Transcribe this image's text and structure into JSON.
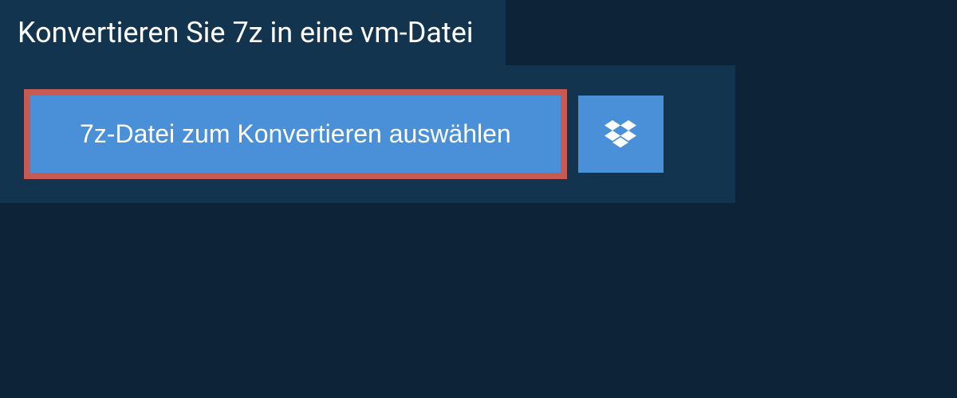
{
  "header": {
    "title": "Konvertieren Sie 7z in eine vm-Datei"
  },
  "main": {
    "select_button_label": "7z-Datei zum Konvertieren auswählen",
    "dropbox_icon": "dropbox"
  },
  "colors": {
    "background": "#0d2438",
    "panel": "#12344f",
    "button": "#4a90d9",
    "highlight_border": "#c85a54"
  }
}
